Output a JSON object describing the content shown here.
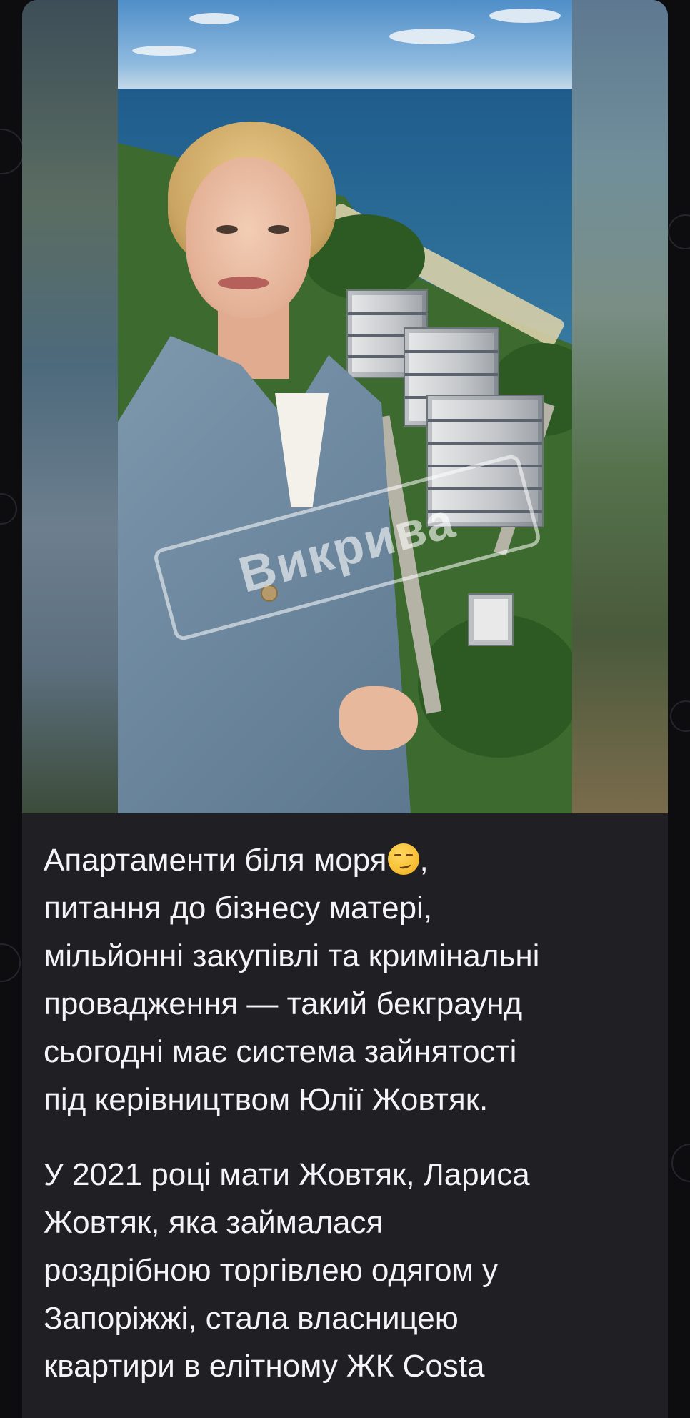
{
  "post": {
    "watermark": "Викрива",
    "paragraphs": [
      {
        "lines": [
          "Апартаменти біля моря",
          "питання до бізнесу матері,",
          "мільйонні закупівлі та кримінальні",
          "провадження — такий бекграунд",
          "сьогодні має система зайнятості",
          "під керівництвом Юлії Жовтяк."
        ],
        "emoji": "smirking-face-icon",
        "emoji_suffix": ","
      },
      {
        "lines": [
          "У 2021 році мати Жовтяк, Лариса",
          "Жовтяк, яка займалася",
          "роздрібною торгівлею одягом у",
          "Запоріжжі, стала власницею",
          "квартири в елітному ЖК Costa"
        ]
      }
    ]
  },
  "colors": {
    "background": "#0d0d10",
    "bubble": "#202024",
    "text": "#f4f4f6"
  }
}
